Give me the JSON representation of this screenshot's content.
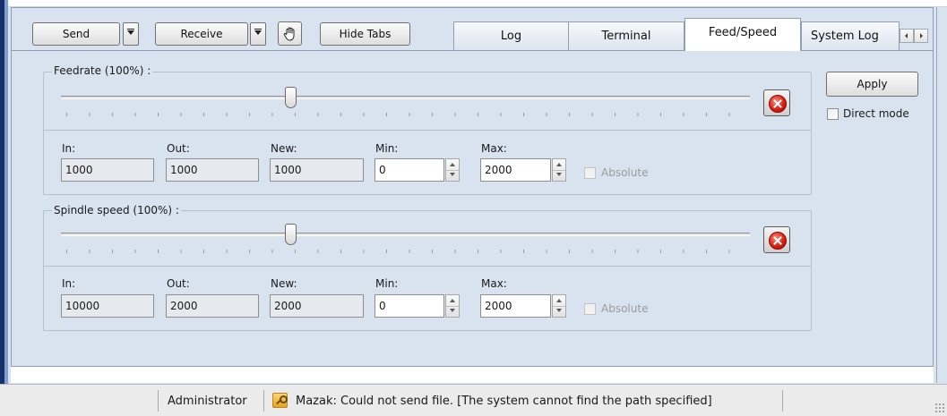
{
  "toolbar": {
    "send_label": "Send",
    "receive_label": "Receive",
    "hand_icon": "hand-icon",
    "hide_tabs_label": "Hide Tabs"
  },
  "tabs": [
    {
      "label": "Log",
      "active": false
    },
    {
      "label": "Terminal",
      "active": false
    },
    {
      "label": "Feed/Speed",
      "active": true
    },
    {
      "label": "System Log",
      "active": false
    }
  ],
  "feedrate": {
    "label": "Feedrate (100%) :",
    "slider_fraction": 0.333,
    "in_label": "In:",
    "in_value": "1000",
    "out_label": "Out:",
    "out_value": "1000",
    "new_label": "New:",
    "new_value": "1000",
    "min_label": "Min:",
    "min_value": "0",
    "max_label": "Max:",
    "max_value": "2000",
    "absolute_label": "Absolute"
  },
  "spindle": {
    "label": "Spindle speed (100%) :",
    "slider_fraction": 0.333,
    "in_label": "In:",
    "in_value": "10000",
    "out_label": "Out:",
    "out_value": "2000",
    "new_label": "New:",
    "new_value": "2000",
    "min_label": "Min:",
    "min_value": "0",
    "max_label": "Max:",
    "max_value": "2000",
    "absolute_label": "Absolute"
  },
  "side": {
    "apply_label": "Apply",
    "direct_mode_label": "Direct mode"
  },
  "status": {
    "user": "Administrator",
    "message": "Mazak: Could not send file. [The system cannot find the path specified]"
  },
  "colors": {
    "background": "#d9e3f0",
    "window_frame": "#16306a",
    "reset_icon": "#d61a0e",
    "status_bar": "#ebebeb"
  }
}
